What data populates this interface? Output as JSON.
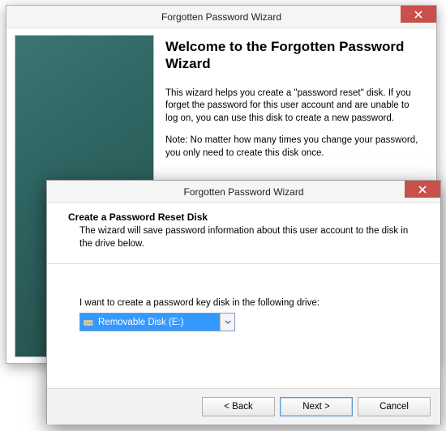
{
  "back_window": {
    "title": "Forgotten Password Wizard",
    "heading": "Welcome to the Forgotten Password Wizard",
    "para1": "This wizard helps you create a \"password reset\" disk. If you forget the password for this user account and are unable to log on, you can use this disk to create a new password.",
    "para2": "Note: No matter how many times you change your password, you only need to create this disk once."
  },
  "front_window": {
    "title": "Forgotten Password Wizard",
    "heading": "Create a Password Reset Disk",
    "subheading": "The wizard will save password information about this user account to the disk in the drive below.",
    "drive_prompt": "I want to create a password key disk in the following drive:",
    "selected_drive": "Removable Disk (E:)",
    "buttons": {
      "back": "< Back",
      "next": "Next >",
      "cancel": "Cancel"
    }
  }
}
